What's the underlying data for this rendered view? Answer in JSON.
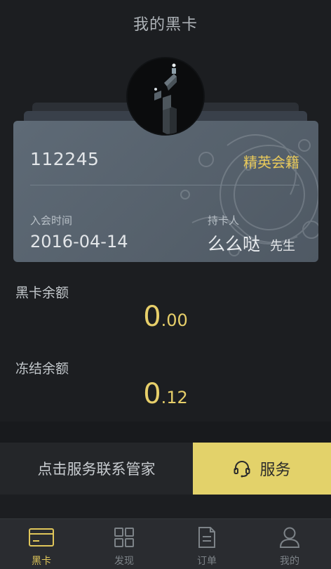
{
  "header": {
    "title": "我的黑卡"
  },
  "card": {
    "number": "112245",
    "level": "精英会籍",
    "join_label": "入会时间",
    "join_date": "2016-04-14",
    "holder_label": "持卡人",
    "holder_name": "么么哒",
    "holder_title": "先生"
  },
  "balances": [
    {
      "label": "黑卡余额",
      "int": "0",
      "dec": ".00"
    },
    {
      "label": "冻结余额",
      "int": "0",
      "dec": ".12"
    }
  ],
  "service": {
    "contact_text": "点击服务联系管家",
    "button_label": "服务",
    "button_icon": "headset-icon"
  },
  "tabs": [
    {
      "label": "黑卡",
      "icon": "card-icon",
      "active": true
    },
    {
      "label": "发现",
      "icon": "grid-icon",
      "active": false
    },
    {
      "label": "订单",
      "icon": "document-icon",
      "active": false
    },
    {
      "label": "我的",
      "icon": "person-icon",
      "active": false
    }
  ],
  "colors": {
    "background": "#1c1e21",
    "accent_gold": "#e7cf6a",
    "service_button": "#e3d26a",
    "card": "#5e6a76"
  }
}
